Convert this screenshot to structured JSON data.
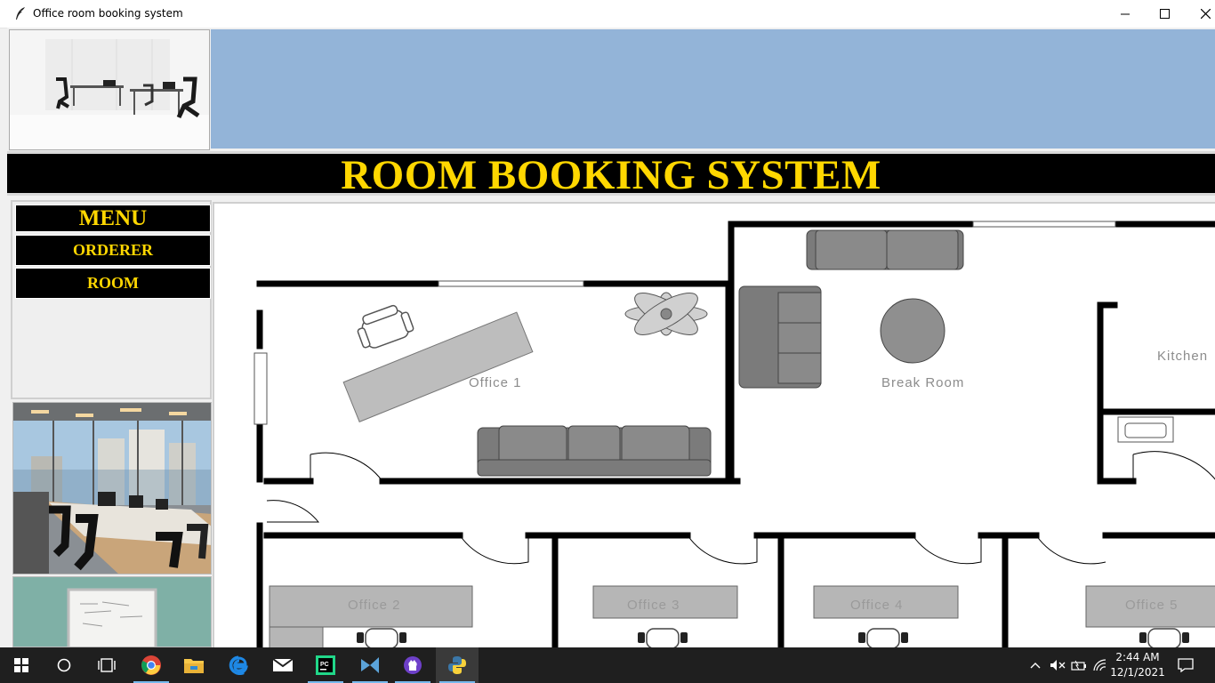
{
  "window": {
    "title": "Office room booking system"
  },
  "header": {
    "band_color": "#93b4d8",
    "banner_title": "ROOM BOOKING SYSTEM",
    "accent": "#ffd700"
  },
  "menu": {
    "heading": "MENU",
    "items": [
      {
        "label": "ORDERER"
      },
      {
        "label": "ROOM"
      }
    ]
  },
  "floorplan": {
    "rooms": [
      "Office 1",
      "Break Room",
      "Kitchen",
      "Office 2",
      "Office 3",
      "Office 4",
      "Office 5"
    ]
  },
  "taskbar": {
    "apps": [
      "start-icon",
      "search-icon",
      "task-view-icon",
      "chrome-icon",
      "file-explorer-icon",
      "edge-icon",
      "mail-icon",
      "pycharm-icon",
      "vscode-icon",
      "github-desktop-icon",
      "python-icon"
    ],
    "time": "2:44 AM",
    "date": "12/1/2021"
  }
}
